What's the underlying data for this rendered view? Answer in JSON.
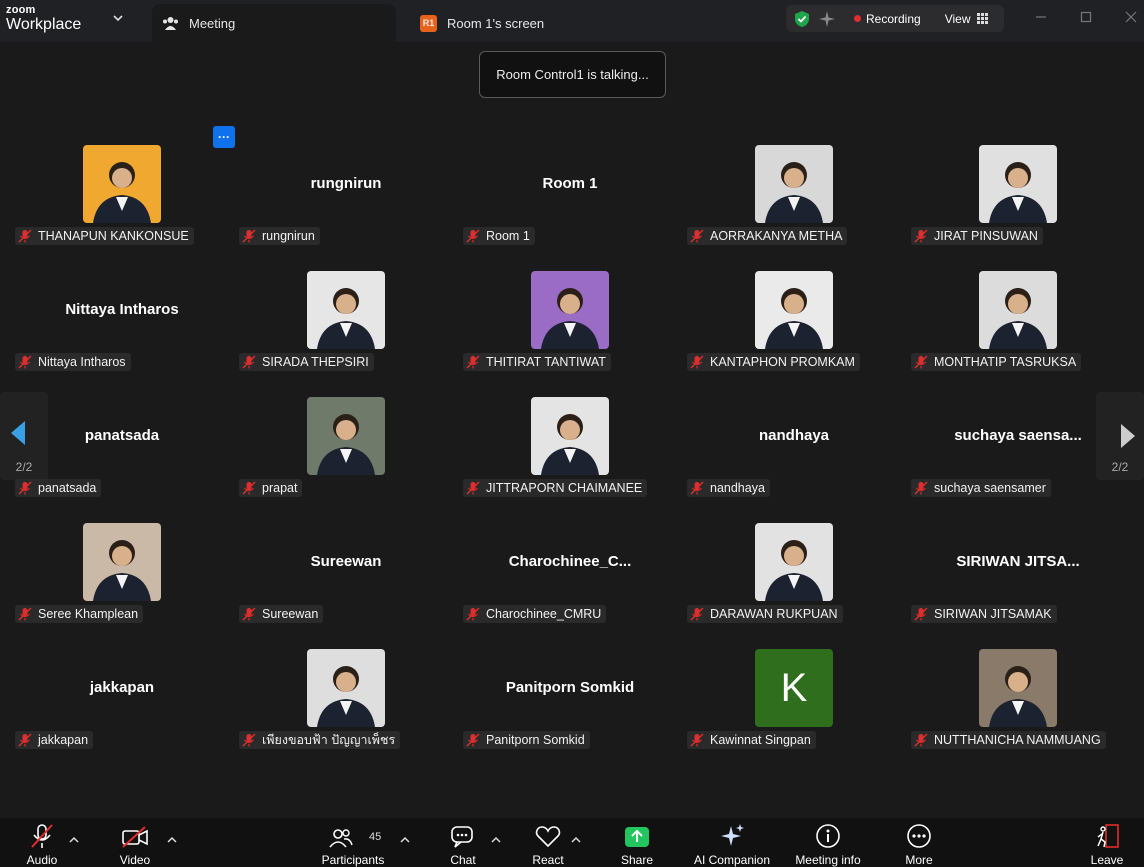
{
  "app": {
    "brand_top": "zoom",
    "brand_bottom": "Workplace"
  },
  "tabs": {
    "meeting": "Meeting",
    "room_badge": "R1",
    "room": "Room 1's screen"
  },
  "recording": {
    "label": "Recording",
    "view_label": "View"
  },
  "talking_tooltip": "Room Control1 is talking...",
  "more_button": "···",
  "pagination": {
    "left": "2/2",
    "right": "2/2"
  },
  "participants": [
    {
      "display": "photo",
      "name": "THANAPUN KANKONSUE",
      "bg": "#f0a830"
    },
    {
      "display": "name",
      "big": "rungnirun",
      "name": "rungnirun"
    },
    {
      "display": "name",
      "big": "Room 1",
      "name": "Room 1"
    },
    {
      "display": "photo",
      "name": "AORRAKANYA METHA",
      "bg": "#d8d8d8"
    },
    {
      "display": "photo",
      "name": "JIRAT PINSUWAN",
      "bg": "#e0e0e0"
    },
    {
      "display": "name",
      "big": "Nittaya Intharos",
      "name": "Nittaya Intharos"
    },
    {
      "display": "photo",
      "name": "SIRADA THEPSIRI",
      "bg": "#e6e6e6"
    },
    {
      "display": "photo",
      "name": "THITIRAT TANTIWAT",
      "bg": "#9a6cc6"
    },
    {
      "display": "photo",
      "name": "KANTAPHON PROMKAM",
      "bg": "#eaeaea"
    },
    {
      "display": "photo",
      "name": "MONTHATIP TASRUKSA",
      "bg": "#dcdcdc"
    },
    {
      "display": "name",
      "big": "panatsada",
      "name": "panatsada"
    },
    {
      "display": "photo",
      "name": "prapat",
      "bg": "#6f7a6a"
    },
    {
      "display": "photo",
      "name": "JITTRAPORN CHAIMANEE",
      "bg": "#e4e4e4"
    },
    {
      "display": "name",
      "big": "nandhaya",
      "name": "nandhaya"
    },
    {
      "display": "name",
      "big": "suchaya  saensa...",
      "name": "suchaya saensamer"
    },
    {
      "display": "photo",
      "name": "Seree Khamplean",
      "bg": "#c9b9a6"
    },
    {
      "display": "name",
      "big": "Sureewan",
      "name": "Sureewan"
    },
    {
      "display": "name",
      "big": "Charochinee_C...",
      "name": "Charochinee_CMRU"
    },
    {
      "display": "photo",
      "name": "DARAWAN RUKPUAN",
      "bg": "#e2e2e2"
    },
    {
      "display": "name",
      "big": "SIRIWAN  JITSA...",
      "name": "SIRIWAN JITSAMAK"
    },
    {
      "display": "name",
      "big": "jakkapan",
      "name": "jakkapan"
    },
    {
      "display": "photo",
      "name": "เพียงขอบฟ้า ปัญญาเพ็ชร",
      "bg": "#dedede"
    },
    {
      "display": "name",
      "big": "Panitporn Somkid",
      "name": "Panitporn Somkid"
    },
    {
      "display": "letter",
      "letter": "K",
      "name": "Kawinnat Singpan",
      "bg": "#2e6e1c"
    },
    {
      "display": "photo",
      "name": "NUTTHANICHA NAMMUANG",
      "bg": "#8a7a6a"
    }
  ],
  "toolbar": {
    "audio": "Audio",
    "video": "Video",
    "participants": "Participants",
    "participant_count": "45",
    "chat": "Chat",
    "react": "React",
    "share": "Share",
    "ai": "AI Companion",
    "info": "Meeting info",
    "more": "More",
    "leave": "Leave"
  },
  "colors": {
    "share_green": "#23c55e",
    "leave_red": "#e02d2d",
    "accent_blue": "#0e72ed",
    "bg": "#1a1a1a"
  }
}
